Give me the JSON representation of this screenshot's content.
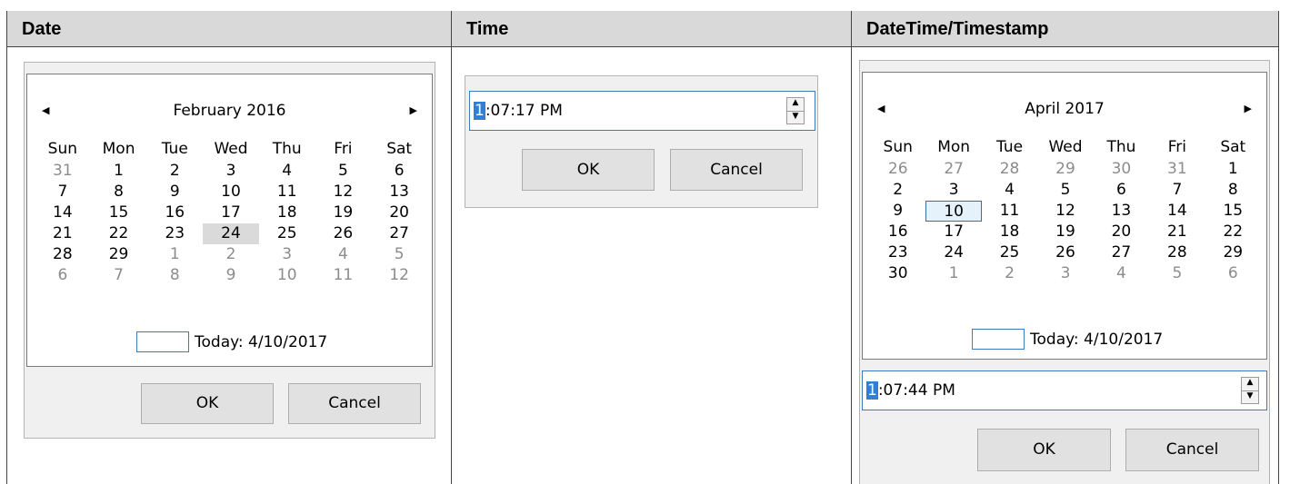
{
  "headers": {
    "date": "Date",
    "time": "Time",
    "datetime": "DateTime/Timestamp"
  },
  "date_dialog": {
    "month_title": "February 2016",
    "prev_icon": "◀",
    "next_icon": "▶",
    "day_names": [
      "Sun",
      "Mon",
      "Tue",
      "Wed",
      "Thu",
      "Fri",
      "Sat"
    ],
    "weeks": [
      [
        "31",
        "1",
        "2",
        "3",
        "4",
        "5",
        "6"
      ],
      [
        "7",
        "8",
        "9",
        "10",
        "11",
        "12",
        "13"
      ],
      [
        "14",
        "15",
        "16",
        "17",
        "18",
        "19",
        "20"
      ],
      [
        "21",
        "22",
        "23",
        "24",
        "25",
        "26",
        "27"
      ],
      [
        "28",
        "29",
        "1",
        "2",
        "3",
        "4",
        "5"
      ],
      [
        "6",
        "7",
        "8",
        "9",
        "10",
        "11",
        "12"
      ]
    ],
    "today_label": "Today: 4/10/2017",
    "ok_label": "OK",
    "cancel_label": "Cancel"
  },
  "time_dialog": {
    "hour_highlight": "1",
    "time_rest": ":07:17 PM",
    "spin_up": "▲",
    "spin_down": "▼",
    "ok_label": "OK",
    "cancel_label": "Cancel"
  },
  "datetime_dialog": {
    "month_title": "April 2017",
    "prev_icon": "◀",
    "next_icon": "▶",
    "day_names": [
      "Sun",
      "Mon",
      "Tue",
      "Wed",
      "Thu",
      "Fri",
      "Sat"
    ],
    "weeks": [
      [
        "26",
        "27",
        "28",
        "29",
        "30",
        "31",
        "1"
      ],
      [
        "2",
        "3",
        "4",
        "5",
        "6",
        "7",
        "8"
      ],
      [
        "9",
        "10",
        "11",
        "12",
        "13",
        "14",
        "15"
      ],
      [
        "16",
        "17",
        "18",
        "19",
        "20",
        "21",
        "22"
      ],
      [
        "23",
        "24",
        "25",
        "26",
        "27",
        "28",
        "29"
      ],
      [
        "30",
        "1",
        "2",
        "3",
        "4",
        "5",
        "6"
      ]
    ],
    "today_label": "Today: 4/10/2017",
    "hour_highlight": "1",
    "time_rest": ":07:44 PM",
    "spin_up": "▲",
    "spin_down": "▼",
    "ok_label": "OK",
    "cancel_label": "Cancel"
  }
}
